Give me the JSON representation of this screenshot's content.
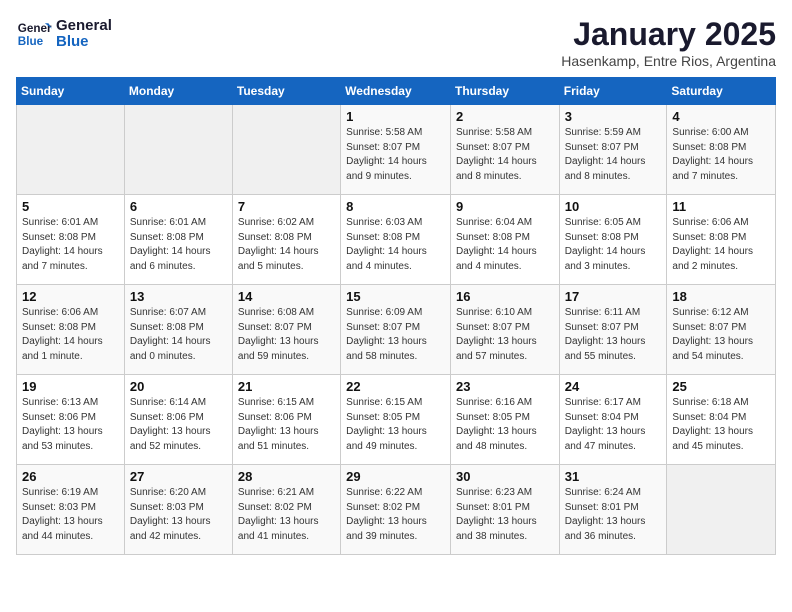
{
  "header": {
    "logo_line1": "General",
    "logo_line2": "Blue",
    "title": "January 2025",
    "subtitle": "Hasenkamp, Entre Rios, Argentina"
  },
  "weekdays": [
    "Sunday",
    "Monday",
    "Tuesday",
    "Wednesday",
    "Thursday",
    "Friday",
    "Saturday"
  ],
  "weeks": [
    [
      {
        "day": "",
        "info": ""
      },
      {
        "day": "",
        "info": ""
      },
      {
        "day": "",
        "info": ""
      },
      {
        "day": "1",
        "info": "Sunrise: 5:58 AM\nSunset: 8:07 PM\nDaylight: 14 hours\nand 9 minutes."
      },
      {
        "day": "2",
        "info": "Sunrise: 5:58 AM\nSunset: 8:07 PM\nDaylight: 14 hours\nand 8 minutes."
      },
      {
        "day": "3",
        "info": "Sunrise: 5:59 AM\nSunset: 8:07 PM\nDaylight: 14 hours\nand 8 minutes."
      },
      {
        "day": "4",
        "info": "Sunrise: 6:00 AM\nSunset: 8:08 PM\nDaylight: 14 hours\nand 7 minutes."
      }
    ],
    [
      {
        "day": "5",
        "info": "Sunrise: 6:01 AM\nSunset: 8:08 PM\nDaylight: 14 hours\nand 7 minutes."
      },
      {
        "day": "6",
        "info": "Sunrise: 6:01 AM\nSunset: 8:08 PM\nDaylight: 14 hours\nand 6 minutes."
      },
      {
        "day": "7",
        "info": "Sunrise: 6:02 AM\nSunset: 8:08 PM\nDaylight: 14 hours\nand 5 minutes."
      },
      {
        "day": "8",
        "info": "Sunrise: 6:03 AM\nSunset: 8:08 PM\nDaylight: 14 hours\nand 4 minutes."
      },
      {
        "day": "9",
        "info": "Sunrise: 6:04 AM\nSunset: 8:08 PM\nDaylight: 14 hours\nand 4 minutes."
      },
      {
        "day": "10",
        "info": "Sunrise: 6:05 AM\nSunset: 8:08 PM\nDaylight: 14 hours\nand 3 minutes."
      },
      {
        "day": "11",
        "info": "Sunrise: 6:06 AM\nSunset: 8:08 PM\nDaylight: 14 hours\nand 2 minutes."
      }
    ],
    [
      {
        "day": "12",
        "info": "Sunrise: 6:06 AM\nSunset: 8:08 PM\nDaylight: 14 hours\nand 1 minute."
      },
      {
        "day": "13",
        "info": "Sunrise: 6:07 AM\nSunset: 8:08 PM\nDaylight: 14 hours\nand 0 minutes."
      },
      {
        "day": "14",
        "info": "Sunrise: 6:08 AM\nSunset: 8:07 PM\nDaylight: 13 hours\nand 59 minutes."
      },
      {
        "day": "15",
        "info": "Sunrise: 6:09 AM\nSunset: 8:07 PM\nDaylight: 13 hours\nand 58 minutes."
      },
      {
        "day": "16",
        "info": "Sunrise: 6:10 AM\nSunset: 8:07 PM\nDaylight: 13 hours\nand 57 minutes."
      },
      {
        "day": "17",
        "info": "Sunrise: 6:11 AM\nSunset: 8:07 PM\nDaylight: 13 hours\nand 55 minutes."
      },
      {
        "day": "18",
        "info": "Sunrise: 6:12 AM\nSunset: 8:07 PM\nDaylight: 13 hours\nand 54 minutes."
      }
    ],
    [
      {
        "day": "19",
        "info": "Sunrise: 6:13 AM\nSunset: 8:06 PM\nDaylight: 13 hours\nand 53 minutes."
      },
      {
        "day": "20",
        "info": "Sunrise: 6:14 AM\nSunset: 8:06 PM\nDaylight: 13 hours\nand 52 minutes."
      },
      {
        "day": "21",
        "info": "Sunrise: 6:15 AM\nSunset: 8:06 PM\nDaylight: 13 hours\nand 51 minutes."
      },
      {
        "day": "22",
        "info": "Sunrise: 6:15 AM\nSunset: 8:05 PM\nDaylight: 13 hours\nand 49 minutes."
      },
      {
        "day": "23",
        "info": "Sunrise: 6:16 AM\nSunset: 8:05 PM\nDaylight: 13 hours\nand 48 minutes."
      },
      {
        "day": "24",
        "info": "Sunrise: 6:17 AM\nSunset: 8:04 PM\nDaylight: 13 hours\nand 47 minutes."
      },
      {
        "day": "25",
        "info": "Sunrise: 6:18 AM\nSunset: 8:04 PM\nDaylight: 13 hours\nand 45 minutes."
      }
    ],
    [
      {
        "day": "26",
        "info": "Sunrise: 6:19 AM\nSunset: 8:03 PM\nDaylight: 13 hours\nand 44 minutes."
      },
      {
        "day": "27",
        "info": "Sunrise: 6:20 AM\nSunset: 8:03 PM\nDaylight: 13 hours\nand 42 minutes."
      },
      {
        "day": "28",
        "info": "Sunrise: 6:21 AM\nSunset: 8:02 PM\nDaylight: 13 hours\nand 41 minutes."
      },
      {
        "day": "29",
        "info": "Sunrise: 6:22 AM\nSunset: 8:02 PM\nDaylight: 13 hours\nand 39 minutes."
      },
      {
        "day": "30",
        "info": "Sunrise: 6:23 AM\nSunset: 8:01 PM\nDaylight: 13 hours\nand 38 minutes."
      },
      {
        "day": "31",
        "info": "Sunrise: 6:24 AM\nSunset: 8:01 PM\nDaylight: 13 hours\nand 36 minutes."
      },
      {
        "day": "",
        "info": ""
      }
    ]
  ]
}
